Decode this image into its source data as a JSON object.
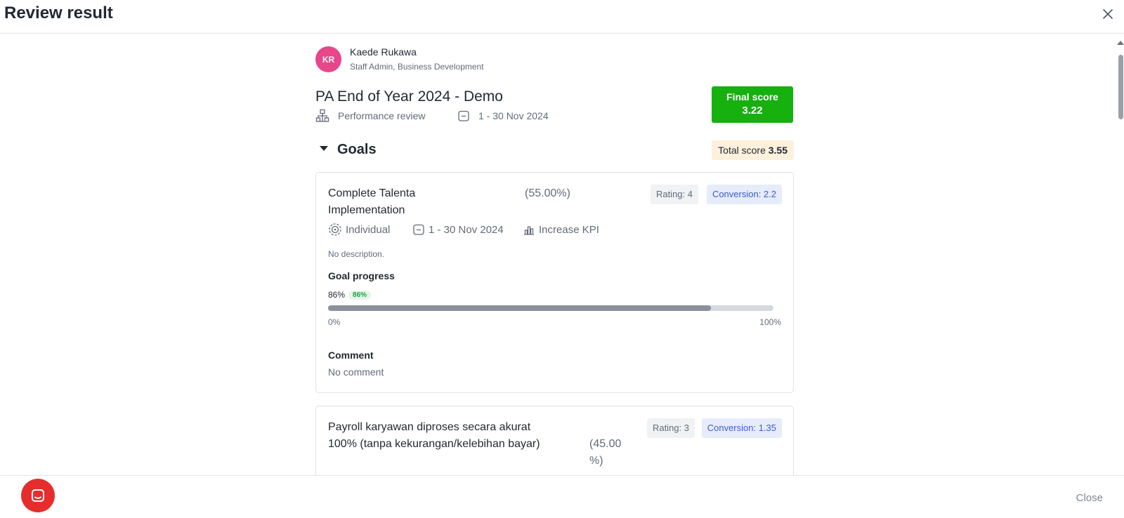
{
  "modal": {
    "title": "Review result",
    "close_label": "Close"
  },
  "employee": {
    "initials": "KR",
    "name": "Kaede Rukawa",
    "role": "Staff Admin, Business Development"
  },
  "review": {
    "title": "PA End of Year 2024 - Demo",
    "type": "Performance review",
    "period": "1 - 30 Nov 2024"
  },
  "final_score": {
    "label": "Final score",
    "value": "3.22"
  },
  "goals_section": {
    "title": "Goals",
    "total_label": "Total score",
    "total_value": "3.55"
  },
  "goals": [
    {
      "name_line1": "Complete Talenta",
      "name_line2": "Implementation",
      "weight": "(55.00%)",
      "rating": "Rating: 4",
      "conversion": "Conversion: 2.2",
      "scope": "Individual",
      "period": "1 - 30 Nov 2024",
      "kpi": "Increase KPI",
      "description": "No description.",
      "progress_label": "Goal progress",
      "progress_value": "86%",
      "progress_badge": "86%",
      "progress_fraction": 0.86,
      "bar_min": "0%",
      "bar_max": "100%",
      "comment_label": "Comment",
      "comment": "No comment"
    },
    {
      "name_line1": "Payroll karyawan diproses secara akurat",
      "name_line2": "100% (tanpa kekurangan/kelebihan bayar)",
      "weight_line1": "(45.00",
      "weight_line2": "%)",
      "rating": "Rating: 3",
      "conversion": "Conversion: 1.35"
    }
  ],
  "colors": {
    "final_score_bg": "#16b00f",
    "avatar_bg": "#e8468a",
    "conversion_text": "#3b5bd5",
    "chat_fab": "#e52d2d"
  }
}
